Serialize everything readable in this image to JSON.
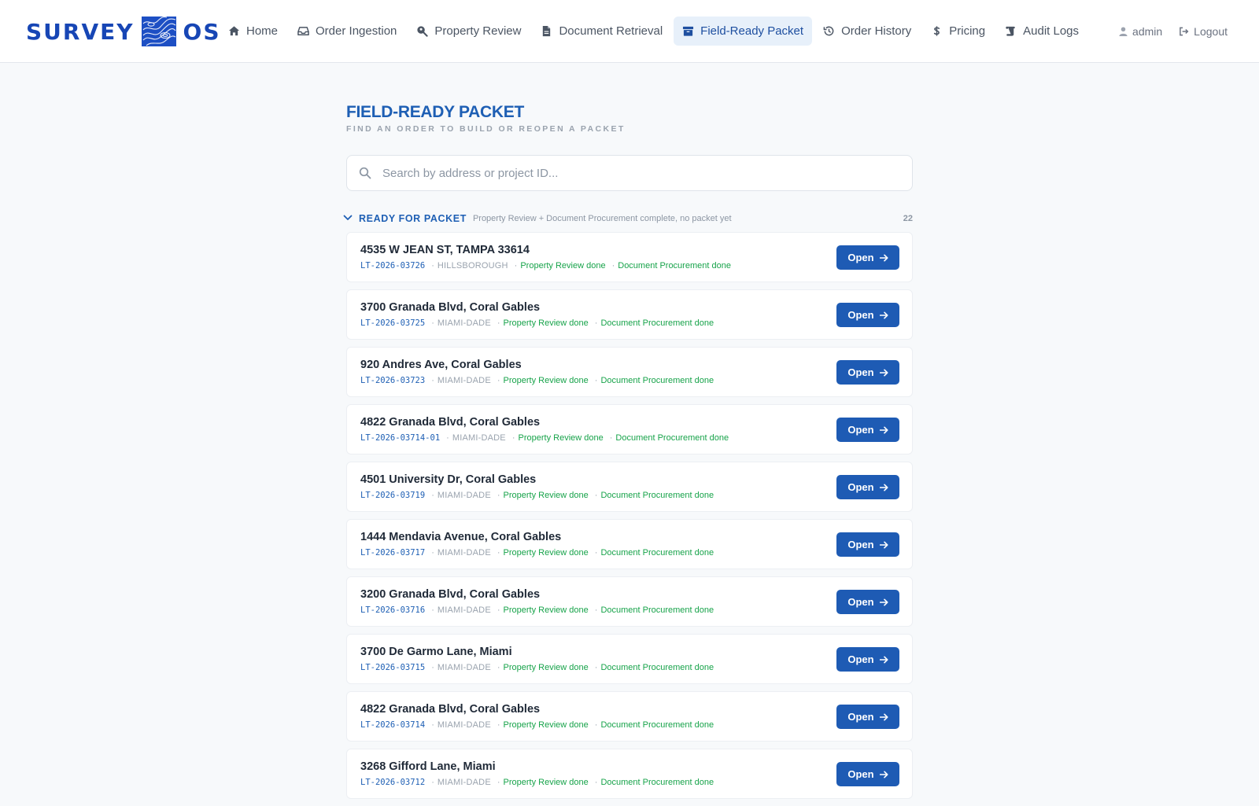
{
  "brand": {
    "word1": "SURVEY",
    "word2": "OS"
  },
  "nav": {
    "items": [
      {
        "label": "Home",
        "icon": "home-icon",
        "active": false
      },
      {
        "label": "Order Ingestion",
        "icon": "inbox-icon",
        "active": false
      },
      {
        "label": "Property Review",
        "icon": "search-location-icon",
        "active": false
      },
      {
        "label": "Document Retrieval",
        "icon": "document-icon",
        "active": false
      },
      {
        "label": "Field-Ready Packet",
        "icon": "archive-icon",
        "active": true
      },
      {
        "label": "Order History",
        "icon": "history-icon",
        "active": false
      },
      {
        "label": "Pricing",
        "icon": "dollar-icon",
        "active": false
      },
      {
        "label": "Audit Logs",
        "icon": "scroll-icon",
        "active": false
      }
    ],
    "user": "admin",
    "logout": "Logout"
  },
  "page": {
    "title": "FIELD-READY PACKET",
    "subtitle": "FIND AN ORDER TO BUILD OR REOPEN A PACKET",
    "search_placeholder": "Search by address or project ID..."
  },
  "section": {
    "title": "READY FOR PACKET",
    "description": "Property Review + Document Procurement complete, no packet yet",
    "count": "22"
  },
  "orders": [
    {
      "address": "4535 W JEAN ST, TAMPA 33614",
      "id": "LT-2026-03726",
      "county": "HILLSBOROUGH",
      "review": "Property Review done",
      "procurement": "Document Procurement done",
      "action": "Open"
    },
    {
      "address": "3700 Granada Blvd, Coral Gables",
      "id": "LT-2026-03725",
      "county": "MIAMI-DADE",
      "review": "Property Review done",
      "procurement": "Document Procurement done",
      "action": "Open"
    },
    {
      "address": "920 Andres Ave, Coral Gables",
      "id": "LT-2026-03723",
      "county": "MIAMI-DADE",
      "review": "Property Review done",
      "procurement": "Document Procurement done",
      "action": "Open"
    },
    {
      "address": "4822 Granada Blvd, Coral Gables",
      "id": "LT-2026-03714-01",
      "county": "MIAMI-DADE",
      "review": "Property Review done",
      "procurement": "Document Procurement done",
      "action": "Open"
    },
    {
      "address": "4501 University Dr, Coral Gables",
      "id": "LT-2026-03719",
      "county": "MIAMI-DADE",
      "review": "Property Review done",
      "procurement": "Document Procurement done",
      "action": "Open"
    },
    {
      "address": "1444 Mendavia Avenue, Coral Gables",
      "id": "LT-2026-03717",
      "county": "MIAMI-DADE",
      "review": "Property Review done",
      "procurement": "Document Procurement done",
      "action": "Open"
    },
    {
      "address": "3200 Granada Blvd, Coral Gables",
      "id": "LT-2026-03716",
      "county": "MIAMI-DADE",
      "review": "Property Review done",
      "procurement": "Document Procurement done",
      "action": "Open"
    },
    {
      "address": "3700 De Garmo Lane, Miami",
      "id": "LT-2026-03715",
      "county": "MIAMI-DADE",
      "review": "Property Review done",
      "procurement": "Document Procurement done",
      "action": "Open"
    },
    {
      "address": "4822 Granada Blvd, Coral Gables",
      "id": "LT-2026-03714",
      "county": "MIAMI-DADE",
      "review": "Property Review done",
      "procurement": "Document Procurement done",
      "action": "Open"
    },
    {
      "address": "3268 Gifford Lane, Miami",
      "id": "LT-2026-03712",
      "county": "MIAMI-DADE",
      "review": "Property Review done",
      "procurement": "Document Procurement done",
      "action": "Open"
    }
  ]
}
